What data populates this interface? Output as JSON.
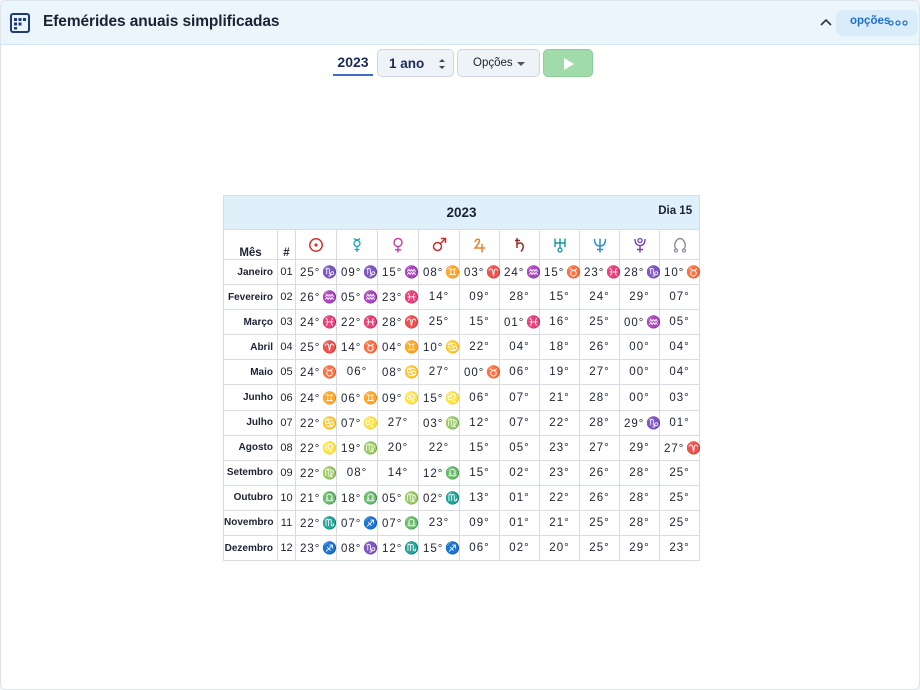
{
  "header": {
    "title": "Efemérides anuais simplificadas",
    "options_label": "opções",
    "icons": {
      "app": "calendar-table-icon",
      "collapse": "chevron-up-icon",
      "more": "more-dots-icon"
    }
  },
  "toolbar": {
    "year": "2023",
    "period": "1 ano",
    "options": "Opções",
    "play_icon": "play-icon"
  },
  "table": {
    "year": "2023",
    "day": "Dia 15",
    "columns": {
      "month": "Mês",
      "index": "#"
    },
    "planets": [
      {
        "name": "sun-icon",
        "color": "#d0302d"
      },
      {
        "name": "mercury-icon",
        "color": "#1aa2b2"
      },
      {
        "name": "venus-icon",
        "color": "#c13ea6"
      },
      {
        "name": "mars-icon",
        "color": "#c4302b"
      },
      {
        "name": "jupiter-icon",
        "color": "#e6832e"
      },
      {
        "name": "saturn-icon",
        "color": "#9a2a20"
      },
      {
        "name": "uranus-icon",
        "color": "#16949a"
      },
      {
        "name": "neptune-icon",
        "color": "#2d8fd0"
      },
      {
        "name": "pluto-icon",
        "color": "#7b3fb0"
      },
      {
        "name": "node-icon",
        "color": "#8a8f98"
      }
    ],
    "rows": [
      {
        "month": "Janeiro",
        "n": "01",
        "cells": [
          [
            "25°",
            "♑"
          ],
          [
            "09°",
            "♑"
          ],
          [
            "15°",
            "♒"
          ],
          [
            "08°",
            "♊"
          ],
          [
            "03°",
            "♈"
          ],
          [
            "24°",
            "♒"
          ],
          [
            "15°",
            "♉"
          ],
          [
            "23°",
            "♓"
          ],
          [
            "28°",
            "♑"
          ],
          [
            "10°",
            "♉"
          ]
        ]
      },
      {
        "month": "Fevereiro",
        "n": "02",
        "cells": [
          [
            "26°",
            "♒"
          ],
          [
            "05°",
            "♒"
          ],
          [
            "23°",
            "♓"
          ],
          [
            "14°",
            ""
          ],
          [
            "09°",
            ""
          ],
          [
            "28°",
            ""
          ],
          [
            "15°",
            ""
          ],
          [
            "24°",
            ""
          ],
          [
            "29°",
            ""
          ],
          [
            "07°",
            ""
          ]
        ]
      },
      {
        "month": "Março",
        "n": "03",
        "cells": [
          [
            "24°",
            "♓"
          ],
          [
            "22°",
            "♓"
          ],
          [
            "28°",
            "♈"
          ],
          [
            "25°",
            ""
          ],
          [
            "15°",
            ""
          ],
          [
            "01°",
            "♓"
          ],
          [
            "16°",
            ""
          ],
          [
            "25°",
            ""
          ],
          [
            "00°",
            "♒"
          ],
          [
            "05°",
            ""
          ]
        ]
      },
      {
        "month": "Abril",
        "n": "04",
        "cells": [
          [
            "25°",
            "♈"
          ],
          [
            "14°",
            "♉"
          ],
          [
            "04°",
            "♊"
          ],
          [
            "10°",
            "♋"
          ],
          [
            "22°",
            ""
          ],
          [
            "04°",
            ""
          ],
          [
            "18°",
            ""
          ],
          [
            "26°",
            ""
          ],
          [
            "00°",
            ""
          ],
          [
            "04°",
            ""
          ]
        ]
      },
      {
        "month": "Maio",
        "n": "05",
        "cells": [
          [
            "24°",
            "♉"
          ],
          [
            "06°",
            ""
          ],
          [
            "08°",
            "♋"
          ],
          [
            "27°",
            ""
          ],
          [
            "00°",
            "♉"
          ],
          [
            "06°",
            ""
          ],
          [
            "19°",
            ""
          ],
          [
            "27°",
            ""
          ],
          [
            "00°",
            ""
          ],
          [
            "04°",
            ""
          ]
        ]
      },
      {
        "month": "Junho",
        "n": "06",
        "cells": [
          [
            "24°",
            "♊"
          ],
          [
            "06°",
            "♊"
          ],
          [
            "09°",
            "♌"
          ],
          [
            "15°",
            "♌"
          ],
          [
            "06°",
            ""
          ],
          [
            "07°",
            ""
          ],
          [
            "21°",
            ""
          ],
          [
            "28°",
            ""
          ],
          [
            "00°",
            ""
          ],
          [
            "03°",
            ""
          ]
        ]
      },
      {
        "month": "Julho",
        "n": "07",
        "cells": [
          [
            "22°",
            "♋"
          ],
          [
            "07°",
            "♌"
          ],
          [
            "27°",
            ""
          ],
          [
            "03°",
            "♍"
          ],
          [
            "12°",
            ""
          ],
          [
            "07°",
            ""
          ],
          [
            "22°",
            ""
          ],
          [
            "28°",
            ""
          ],
          [
            "29°",
            "♑"
          ],
          [
            "01°",
            ""
          ]
        ]
      },
      {
        "month": "Agosto",
        "n": "08",
        "cells": [
          [
            "22°",
            "♌"
          ],
          [
            "19°",
            "♍"
          ],
          [
            "20°",
            ""
          ],
          [
            "22°",
            ""
          ],
          [
            "15°",
            ""
          ],
          [
            "05°",
            ""
          ],
          [
            "23°",
            ""
          ],
          [
            "27°",
            ""
          ],
          [
            "29°",
            ""
          ],
          [
            "27°",
            "♈"
          ]
        ]
      },
      {
        "month": "Setembro",
        "n": "09",
        "cells": [
          [
            "22°",
            "♍"
          ],
          [
            "08°",
            ""
          ],
          [
            "14°",
            ""
          ],
          [
            "12°",
            "♎"
          ],
          [
            "15°",
            ""
          ],
          [
            "02°",
            ""
          ],
          [
            "23°",
            ""
          ],
          [
            "26°",
            ""
          ],
          [
            "28°",
            ""
          ],
          [
            "25°",
            ""
          ]
        ]
      },
      {
        "month": "Outubro",
        "n": "10",
        "cells": [
          [
            "21°",
            "♎"
          ],
          [
            "18°",
            "♎"
          ],
          [
            "05°",
            "♍"
          ],
          [
            "02°",
            "♏"
          ],
          [
            "13°",
            ""
          ],
          [
            "01°",
            ""
          ],
          [
            "22°",
            ""
          ],
          [
            "26°",
            ""
          ],
          [
            "28°",
            ""
          ],
          [
            "25°",
            ""
          ]
        ]
      },
      {
        "month": "Novembro",
        "n": "11",
        "cells": [
          [
            "22°",
            "♏"
          ],
          [
            "07°",
            "♐"
          ],
          [
            "07°",
            "♎"
          ],
          [
            "23°",
            ""
          ],
          [
            "09°",
            ""
          ],
          [
            "01°",
            ""
          ],
          [
            "21°",
            ""
          ],
          [
            "25°",
            ""
          ],
          [
            "28°",
            ""
          ],
          [
            "25°",
            ""
          ]
        ]
      },
      {
        "month": "Dezembro",
        "n": "12",
        "cells": [
          [
            "23°",
            "♐"
          ],
          [
            "08°",
            "♑"
          ],
          [
            "12°",
            "♏"
          ],
          [
            "15°",
            "♐"
          ],
          [
            "06°",
            ""
          ],
          [
            "02°",
            ""
          ],
          [
            "20°",
            ""
          ],
          [
            "25°",
            ""
          ],
          [
            "29°",
            ""
          ],
          [
            "23°",
            ""
          ]
        ]
      }
    ]
  }
}
